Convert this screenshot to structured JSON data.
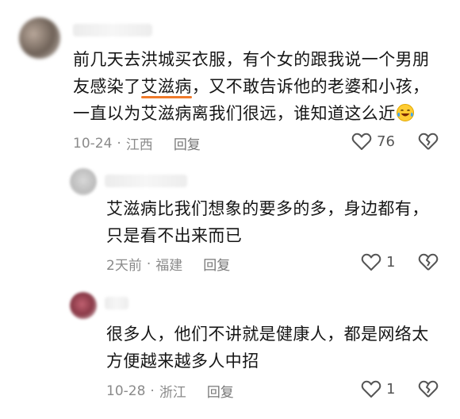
{
  "comments": [
    {
      "text_before": "前几天去洪城买衣服，有个女的跟我说一个男朋友感染了",
      "line1": "前几天去洪城买衣服，有个女的跟我说一个男朋",
      "line2_pre": "友感染了",
      "highlight": "艾滋病",
      "line2_post": "，又不敢告诉他的老婆和小孩，",
      "line3": "一直以为艾滋病离我们很远，谁知道这么近",
      "date": "10-24",
      "location": "江西",
      "reply_label": "回复",
      "likes": "76"
    },
    {
      "line1": "艾滋病比我们想象的要多的多，身边都有，",
      "line2": "只是看不出来而已",
      "date": "2天前",
      "location": "福建",
      "reply_label": "回复",
      "likes": "1"
    },
    {
      "line1": "很多人，他们不讲就是健康人，都是网络太",
      "line2": "方便越来越多人中招",
      "date": "10-28",
      "location": "浙江",
      "reply_label": "回复",
      "likes": "1"
    }
  ],
  "meta_separator": "·",
  "icons": {
    "like": "heart-outline-icon",
    "dislike": "broken-heart-icon",
    "emoji": "laughing-tears-emoji"
  },
  "colors": {
    "highlight_underline": "#f07a2a",
    "meta_text": "#8a8a8a"
  }
}
